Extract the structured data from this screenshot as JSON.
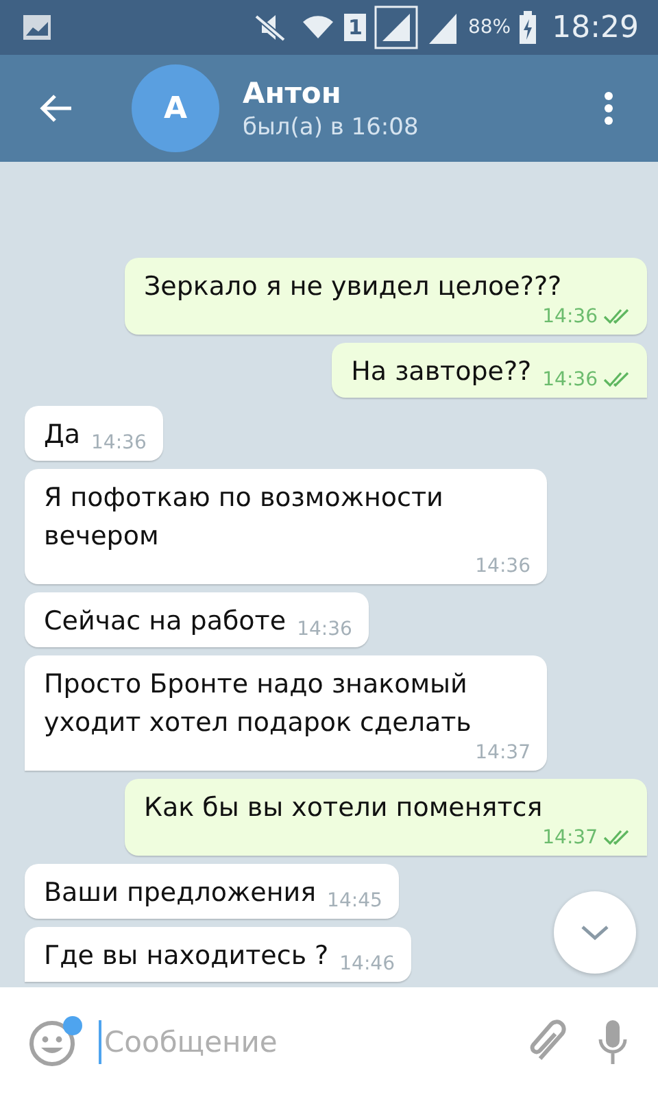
{
  "status_bar": {
    "battery": "88%",
    "time": "18:29",
    "sim": "1"
  },
  "header": {
    "avatar_letter": "А",
    "name": "Антон",
    "last_seen": "был(а) в 16:08"
  },
  "messages": [
    {
      "kind": "outgoing",
      "text": "Зеркало я не увидел целое???",
      "time": "14:36",
      "read": true,
      "tail": false
    },
    {
      "kind": "outgoing",
      "text": "На завторе??",
      "time": "14:36",
      "read": true,
      "tail": true
    },
    {
      "kind": "incoming",
      "text": "Да",
      "time": "14:36",
      "tail": false
    },
    {
      "kind": "incoming",
      "text": "Я пофоткаю по возможности вечером",
      "time": "14:36",
      "tail": false
    },
    {
      "kind": "incoming",
      "text": "Сейчас на работе",
      "time": "14:36",
      "tail": false
    },
    {
      "kind": "incoming",
      "text": "Просто Бронте надо знакомый уходит хотел подарок сделать",
      "time": "14:37",
      "tail": true
    },
    {
      "kind": "outgoing",
      "text": "Как бы вы хотели поменятся",
      "time": "14:37",
      "read": true,
      "tail": true
    },
    {
      "kind": "incoming",
      "text": "Ваши предложения",
      "time": "14:45",
      "tail": false
    },
    {
      "kind": "incoming",
      "text": "Где вы находитесь ?",
      "time": "14:46",
      "tail": true
    }
  ],
  "composer": {
    "placeholder": "Сообщение",
    "emoji_badge": true
  }
}
